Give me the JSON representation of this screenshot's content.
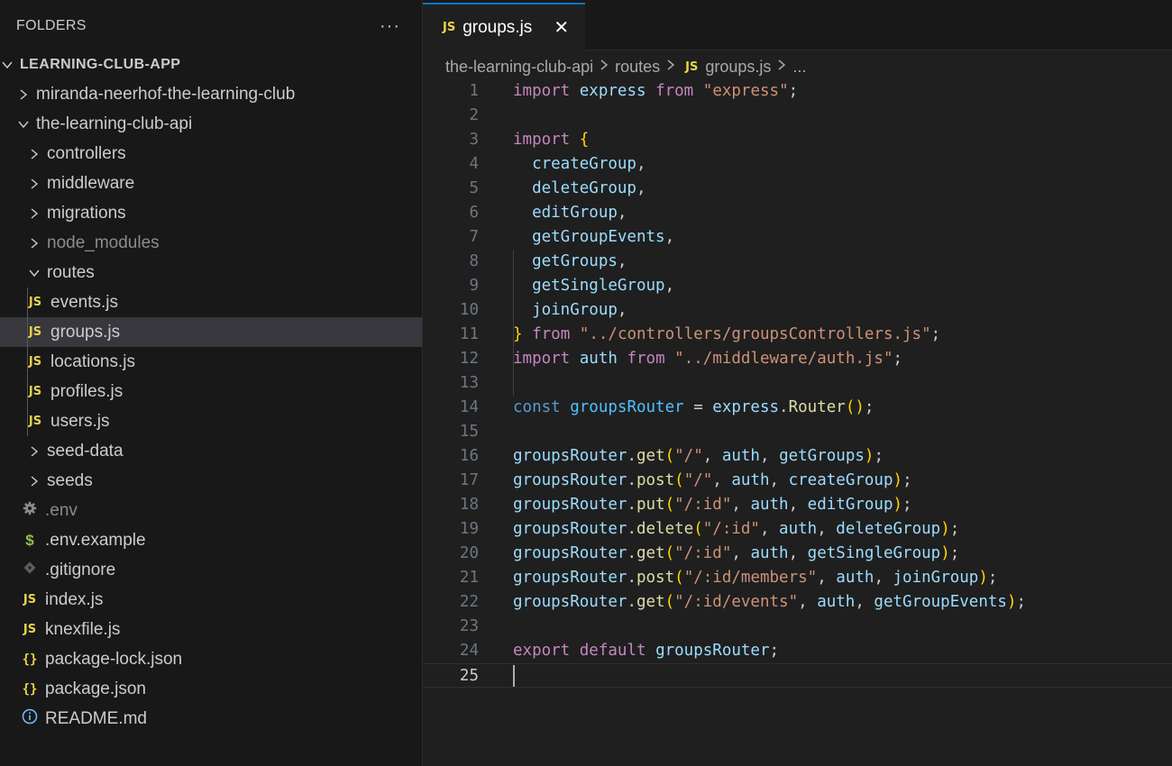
{
  "sidebar": {
    "title": "FOLDERS",
    "more": "···",
    "items": [
      {
        "label": "LEARNING-CLUB-APP",
        "icon": "chevron-down-icon",
        "indent": 0,
        "kind": "root"
      },
      {
        "label": "miranda-neerhof-the-learning-club",
        "icon": "chevron-right-icon",
        "indent": 1
      },
      {
        "label": "the-learning-club-api",
        "icon": "chevron-down-icon",
        "indent": 1
      },
      {
        "label": "controllers",
        "icon": "chevron-right-icon",
        "indent": 2
      },
      {
        "label": "middleware",
        "icon": "chevron-right-icon",
        "indent": 2
      },
      {
        "label": "migrations",
        "icon": "chevron-right-icon",
        "indent": 2
      },
      {
        "label": "node_modules",
        "icon": "chevron-right-icon",
        "indent": 2,
        "dim": true
      },
      {
        "label": "routes",
        "icon": "chevron-down-icon",
        "indent": 2
      },
      {
        "label": "events.js",
        "icon": "js-file-icon",
        "indent": 3
      },
      {
        "label": "groups.js",
        "icon": "js-file-icon",
        "indent": 3,
        "selected": true
      },
      {
        "label": "locations.js",
        "icon": "js-file-icon",
        "indent": 3
      },
      {
        "label": "profiles.js",
        "icon": "js-file-icon",
        "indent": 3
      },
      {
        "label": "users.js",
        "icon": "js-file-icon",
        "indent": 3
      },
      {
        "label": "seed-data",
        "icon": "chevron-right-icon",
        "indent": 2
      },
      {
        "label": "seeds",
        "icon": "chevron-right-icon",
        "indent": 2
      },
      {
        "label": ".env",
        "icon": "gear-icon",
        "indent": 2,
        "dim": true
      },
      {
        "label": ".env.example",
        "icon": "dollar-icon",
        "indent": 2
      },
      {
        "label": ".gitignore",
        "icon": "git-diamond-icon",
        "indent": 2
      },
      {
        "label": "index.js",
        "icon": "js-file-icon",
        "indent": 2
      },
      {
        "label": "knexfile.js",
        "icon": "js-file-icon",
        "indent": 2
      },
      {
        "label": "package-lock.json",
        "icon": "json-braces-icon",
        "indent": 2
      },
      {
        "label": "package.json",
        "icon": "json-braces-icon",
        "indent": 2
      },
      {
        "label": "README.md",
        "icon": "info-icon",
        "indent": 2
      }
    ]
  },
  "icons": {
    "js": "JS",
    "json": "{}",
    "dollar": "$"
  },
  "editor": {
    "tab": {
      "label": "groups.js",
      "close": "✕"
    },
    "breadcrumb": [
      "the-learning-club-api",
      "routes",
      "groups.js",
      "..."
    ],
    "current_line": 25,
    "lines": [
      [
        [
          "kw",
          "import"
        ],
        [
          "pl",
          " "
        ],
        [
          "var",
          "express"
        ],
        [
          "pl",
          " "
        ],
        [
          "kw",
          "from"
        ],
        [
          "pl",
          " "
        ],
        [
          "str",
          "\"express\""
        ],
        [
          "pl",
          ";"
        ]
      ],
      [],
      [
        [
          "kw",
          "import"
        ],
        [
          "pl",
          " "
        ],
        [
          "br1",
          "{"
        ]
      ],
      [
        [
          "pl",
          "  "
        ],
        [
          "var",
          "createGroup"
        ],
        [
          "pl",
          ","
        ]
      ],
      [
        [
          "pl",
          "  "
        ],
        [
          "var",
          "deleteGroup"
        ],
        [
          "pl",
          ","
        ]
      ],
      [
        [
          "pl",
          "  "
        ],
        [
          "var",
          "editGroup"
        ],
        [
          "pl",
          ","
        ]
      ],
      [
        [
          "pl",
          "  "
        ],
        [
          "var",
          "getGroupEvents"
        ],
        [
          "pl",
          ","
        ]
      ],
      [
        [
          "pl",
          "  "
        ],
        [
          "var",
          "getGroups"
        ],
        [
          "pl",
          ","
        ]
      ],
      [
        [
          "pl",
          "  "
        ],
        [
          "var",
          "getSingleGroup"
        ],
        [
          "pl",
          ","
        ]
      ],
      [
        [
          "pl",
          "  "
        ],
        [
          "var",
          "joinGroup"
        ],
        [
          "pl",
          ","
        ]
      ],
      [
        [
          "br1",
          "}"
        ],
        [
          "pl",
          " "
        ],
        [
          "kw",
          "from"
        ],
        [
          "pl",
          " "
        ],
        [
          "str",
          "\"../controllers/groupsControllers.js\""
        ],
        [
          "pl",
          ";"
        ]
      ],
      [
        [
          "kw",
          "import"
        ],
        [
          "pl",
          " "
        ],
        [
          "var",
          "auth"
        ],
        [
          "pl",
          " "
        ],
        [
          "kw",
          "from"
        ],
        [
          "pl",
          " "
        ],
        [
          "str",
          "\"../middleware/auth.js\""
        ],
        [
          "pl",
          ";"
        ]
      ],
      [],
      [
        [
          "kb",
          "const"
        ],
        [
          "pl",
          " "
        ],
        [
          "cst",
          "groupsRouter"
        ],
        [
          "pl",
          " = "
        ],
        [
          "var",
          "express"
        ],
        [
          "pl",
          "."
        ],
        [
          "fn",
          "Router"
        ],
        [
          "br1",
          "()"
        ],
        [
          "pl",
          ";"
        ]
      ],
      [],
      [
        [
          "var",
          "groupsRouter"
        ],
        [
          "pl",
          "."
        ],
        [
          "fn",
          "get"
        ],
        [
          "br1",
          "("
        ],
        [
          "str",
          "\"/\""
        ],
        [
          "pl",
          ", "
        ],
        [
          "var",
          "auth"
        ],
        [
          "pl",
          ", "
        ],
        [
          "var",
          "getGroups"
        ],
        [
          "br1",
          ")"
        ],
        [
          "pl",
          ";"
        ]
      ],
      [
        [
          "var",
          "groupsRouter"
        ],
        [
          "pl",
          "."
        ],
        [
          "fn",
          "post"
        ],
        [
          "br1",
          "("
        ],
        [
          "str",
          "\"/\""
        ],
        [
          "pl",
          ", "
        ],
        [
          "var",
          "auth"
        ],
        [
          "pl",
          ", "
        ],
        [
          "var",
          "createGroup"
        ],
        [
          "br1",
          ")"
        ],
        [
          "pl",
          ";"
        ]
      ],
      [
        [
          "var",
          "groupsRouter"
        ],
        [
          "pl",
          "."
        ],
        [
          "fn",
          "put"
        ],
        [
          "br1",
          "("
        ],
        [
          "str",
          "\"/:id\""
        ],
        [
          "pl",
          ", "
        ],
        [
          "var",
          "auth"
        ],
        [
          "pl",
          ", "
        ],
        [
          "var",
          "editGroup"
        ],
        [
          "br1",
          ")"
        ],
        [
          "pl",
          ";"
        ]
      ],
      [
        [
          "var",
          "groupsRouter"
        ],
        [
          "pl",
          "."
        ],
        [
          "fn",
          "delete"
        ],
        [
          "br1",
          "("
        ],
        [
          "str",
          "\"/:id\""
        ],
        [
          "pl",
          ", "
        ],
        [
          "var",
          "auth"
        ],
        [
          "pl",
          ", "
        ],
        [
          "var",
          "deleteGroup"
        ],
        [
          "br1",
          ")"
        ],
        [
          "pl",
          ";"
        ]
      ],
      [
        [
          "var",
          "groupsRouter"
        ],
        [
          "pl",
          "."
        ],
        [
          "fn",
          "get"
        ],
        [
          "br1",
          "("
        ],
        [
          "str",
          "\"/:id\""
        ],
        [
          "pl",
          ", "
        ],
        [
          "var",
          "auth"
        ],
        [
          "pl",
          ", "
        ],
        [
          "var",
          "getSingleGroup"
        ],
        [
          "br1",
          ")"
        ],
        [
          "pl",
          ";"
        ]
      ],
      [
        [
          "var",
          "groupsRouter"
        ],
        [
          "pl",
          "."
        ],
        [
          "fn",
          "post"
        ],
        [
          "br1",
          "("
        ],
        [
          "str",
          "\"/:id/members\""
        ],
        [
          "pl",
          ", "
        ],
        [
          "var",
          "auth"
        ],
        [
          "pl",
          ", "
        ],
        [
          "var",
          "joinGroup"
        ],
        [
          "br1",
          ")"
        ],
        [
          "pl",
          ";"
        ]
      ],
      [
        [
          "var",
          "groupsRouter"
        ],
        [
          "pl",
          "."
        ],
        [
          "fn",
          "get"
        ],
        [
          "br1",
          "("
        ],
        [
          "str",
          "\"/:id/events\""
        ],
        [
          "pl",
          ", "
        ],
        [
          "var",
          "auth"
        ],
        [
          "pl",
          ", "
        ],
        [
          "var",
          "getGroupEvents"
        ],
        [
          "br1",
          ")"
        ],
        [
          "pl",
          ";"
        ]
      ],
      [],
      [
        [
          "kw",
          "export"
        ],
        [
          "pl",
          " "
        ],
        [
          "kw",
          "default"
        ],
        [
          "pl",
          " "
        ],
        [
          "var",
          "groupsRouter"
        ],
        [
          "pl",
          ";"
        ]
      ],
      []
    ]
  },
  "colors": {
    "sidebar_bg": "#181818",
    "editor_bg": "#1f1f1f",
    "selection": "#37373d",
    "tab_accent": "#0078d4",
    "js_icon": "#e8d44d"
  }
}
